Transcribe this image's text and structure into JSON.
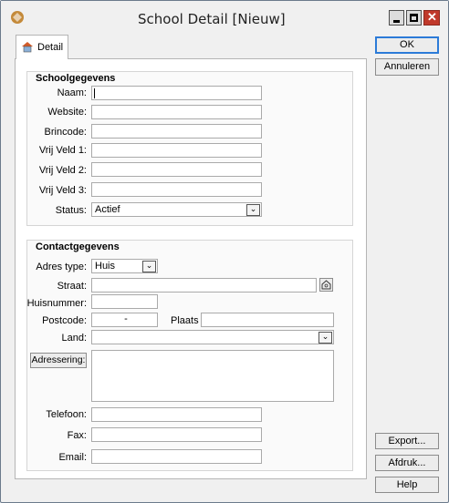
{
  "window": {
    "title": "School Detail [Nieuw]"
  },
  "tab": {
    "label": "Detail"
  },
  "school": {
    "heading": "Schoolgegevens",
    "naam_label": "Naam:",
    "website_label": "Website:",
    "brincode_label": "Brincode:",
    "vrij1_label": "Vrij Veld 1:",
    "vrij2_label": "Vrij Veld 2:",
    "vrij3_label": "Vrij Veld 3:",
    "status_label": "Status:",
    "status_value": "Actief"
  },
  "contact": {
    "heading": "Contactgegevens",
    "adres_type_label": "Adres type:",
    "adres_type_value": "Huis",
    "straat_label": "Straat:",
    "huisnummer_label": "Huisnummer:",
    "postcode_label": "Postcode:",
    "postcode_value": "-",
    "plaats_label": "Plaats",
    "land_label": "Land:",
    "adressering_label": "Adressering:",
    "telefoon_label": "Telefoon:",
    "fax_label": "Fax:",
    "email_label": "Email:"
  },
  "buttons": {
    "ok": "OK",
    "annuleren": "Annuleren",
    "export": "Export...",
    "afdruk": "Afdruk...",
    "help": "Help"
  },
  "icons": {
    "app": "app-icon",
    "tab": "school-icon",
    "address_lookup": "home-icon",
    "dropdown": "chevron-down-icon"
  }
}
